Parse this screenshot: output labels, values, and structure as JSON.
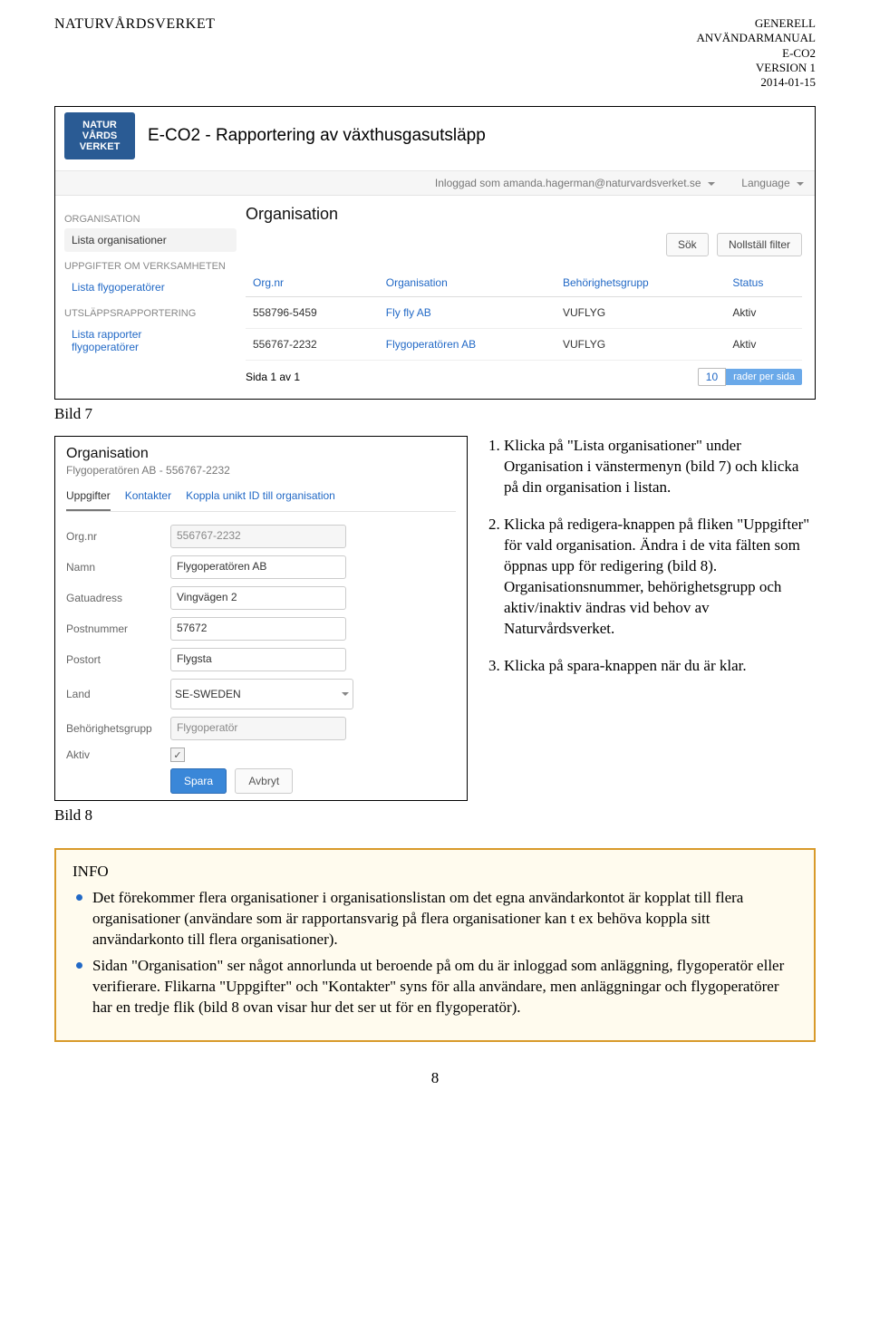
{
  "header": {
    "left": "NATURVÅRDSVERKET",
    "right_lines": [
      "GENERELL",
      "ANVÄNDARMANUAL",
      "E-CO2",
      "VERSION 1",
      "2014-01-15"
    ]
  },
  "bild7": {
    "caption": "Bild 7",
    "logo_lines": [
      "NATUR",
      "VÅRDS",
      "VERKET"
    ],
    "app_title": "E-CO2 - Rapportering av växthusgasutsläpp",
    "topbar": {
      "logged_in": "Inloggad som amanda.hagerman@naturvardsverket.se",
      "language": "Language"
    },
    "sidebar": {
      "sec1": "ORGANISATION",
      "item1": "Lista organisationer",
      "sec2": "UPPGIFTER OM VERKSAMHETEN",
      "item2": "Lista flygoperatörer",
      "sec3": "UTSLÄPPSRAPPORTERING",
      "item3a": "Lista rapporter",
      "item3b": "flygoperatörer"
    },
    "main": {
      "title": "Organisation",
      "btn_search": "Sök",
      "btn_reset": "Nollställ filter",
      "columns": [
        "Org.nr",
        "Organisation",
        "Behörighetsgrupp",
        "Status"
      ],
      "rows": [
        {
          "orgnr": "558796-5459",
          "org": "Fly fly AB",
          "grp": "VUFLYG",
          "status": "Aktiv"
        },
        {
          "orgnr": "556767-2232",
          "org": "Flygoperatören AB",
          "grp": "VUFLYG",
          "status": "Aktiv"
        }
      ],
      "pager_left": "Sida 1 av 1",
      "pager_num": "10",
      "pager_lbl": "rader per sida"
    }
  },
  "bild8": {
    "caption": "Bild 8",
    "title": "Organisation",
    "subtitle": "Flygoperatören AB - 556767-2232",
    "tabs": [
      "Uppgifter",
      "Kontakter",
      "Koppla unikt ID till organisation"
    ],
    "fields": {
      "orgnr_lbl": "Org.nr",
      "orgnr_val": "556767-2232",
      "namn_lbl": "Namn",
      "namn_val": "Flygoperatören AB",
      "gatu_lbl": "Gatuadress",
      "gatu_val": "Vingvägen 2",
      "post_lbl": "Postnummer",
      "post_val": "57672",
      "ort_lbl": "Postort",
      "ort_val": "Flygsta",
      "land_lbl": "Land",
      "land_val": "SE-SWEDEN",
      "beh_lbl": "Behörighetsgrupp",
      "beh_val": "Flygoperatör",
      "aktiv_lbl": "Aktiv"
    },
    "btn_save": "Spara",
    "btn_cancel": "Avbryt"
  },
  "instructions": {
    "i1": "Klicka på \"Lista organisationer\" under Organisation i vänstermenyn (bild 7) och klicka på din organisation i listan.",
    "i2": "Klicka på redigera-knappen på fliken \"Uppgifter\" för vald organisation. Ändra i de vita fälten som öppnas upp för redigering (bild 8). Organisationsnummer, behörighetsgrupp och aktiv/inaktiv ändras vid behov av Naturvårdsverket.",
    "i3": "Klicka på spara-knappen när du är klar."
  },
  "info": {
    "title": "INFO",
    "b1": "Det förekommer flera organisationer i organisationslistan om det egna användarkontot är kopplat till flera organisationer (användare som är rapportansvarig på flera organisationer kan t ex behöva koppla sitt användarkonto till flera organisationer).",
    "b2": "Sidan \"Organisation\" ser något annorlunda ut beroende på om du är inloggad som anläggning, flygoperatör eller verifierare. Flikarna \"Uppgifter\" och \"Kontakter\" syns för alla användare, men anläggningar och flygoperatörer har en tredje flik (bild 8 ovan visar hur det ser ut för en flygoperatör)."
  },
  "page_number": "8"
}
